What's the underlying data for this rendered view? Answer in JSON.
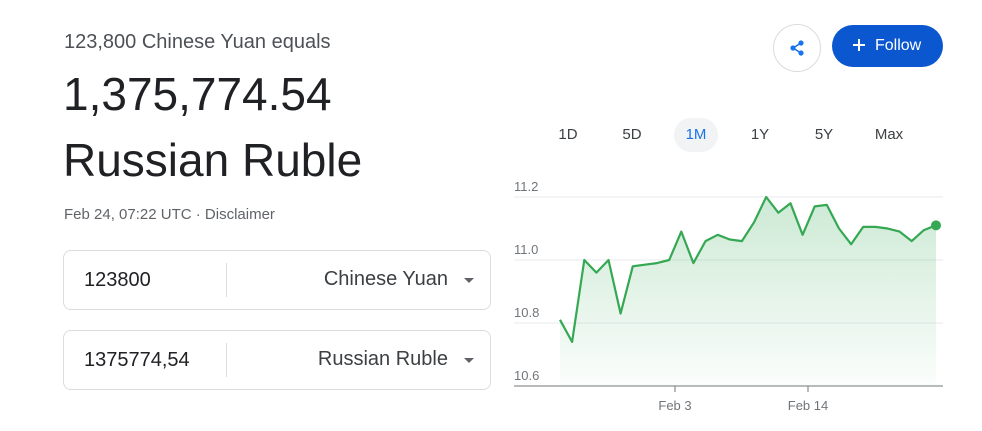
{
  "header": {
    "subtitle": "123,800 Chinese Yuan equals",
    "result_amount": "1,375,774.54",
    "result_currency": "Russian Ruble",
    "timestamp": "Feb 24, 07:22 UTC",
    "separator": "·",
    "disclaimer": "Disclaimer"
  },
  "converter": {
    "from": {
      "amount": "123800",
      "currency": "Chinese Yuan"
    },
    "to": {
      "amount": "1375774,54",
      "currency": "Russian Ruble"
    }
  },
  "actions": {
    "share_icon": "share-icon",
    "follow_label": "Follow",
    "follow_icon": "plus-icon",
    "accent": "#0b57d0"
  },
  "ranges": {
    "items": [
      "1D",
      "5D",
      "1M",
      "1Y",
      "5Y",
      "Max"
    ],
    "selected": "1M"
  },
  "chart_data": {
    "type": "area",
    "color": "#34a853",
    "grid": true,
    "ylim": [
      10.6,
      11.2
    ],
    "yticks": [
      "11.2",
      "11.0",
      "10.8",
      "10.6"
    ],
    "xticks": [
      "Feb 3",
      "Feb 14"
    ],
    "values": [
      10.81,
      10.74,
      11.0,
      10.96,
      11.0,
      10.83,
      10.98,
      10.985,
      10.99,
      11.0,
      11.09,
      10.99,
      11.06,
      11.08,
      11.065,
      11.06,
      11.12,
      11.2,
      11.15,
      11.18,
      11.08,
      11.17,
      11.175,
      11.1,
      11.05,
      11.105,
      11.105,
      11.1,
      11.09,
      11.06,
      11.095,
      11.11
    ]
  }
}
